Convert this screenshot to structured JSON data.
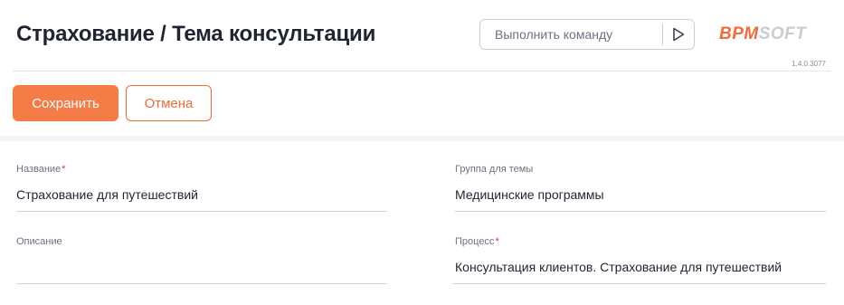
{
  "header": {
    "title": "Страхование / Тема консультации",
    "command_placeholder": "Выполнить команду",
    "run_icon": "play-triangle-icon",
    "logo_bpm": "BPM",
    "logo_soft": "SOFT",
    "version": "1.4.0.3077"
  },
  "toolbar": {
    "save_label": "Сохранить",
    "cancel_label": "Отмена"
  },
  "form": {
    "name": {
      "label": "Название",
      "required": "*",
      "value": "Страхование для путешествий"
    },
    "group": {
      "label": "Группа для темы",
      "value": "Медицинские программы"
    },
    "description": {
      "label": "Описание",
      "value": ""
    },
    "process": {
      "label": "Процесс",
      "required": "*",
      "value": "Консультация клиентов. Страхование для путешествий"
    }
  },
  "colors": {
    "accent": "#f26b37",
    "save_button": "#f47c46",
    "required_marker": "#e0313b"
  }
}
